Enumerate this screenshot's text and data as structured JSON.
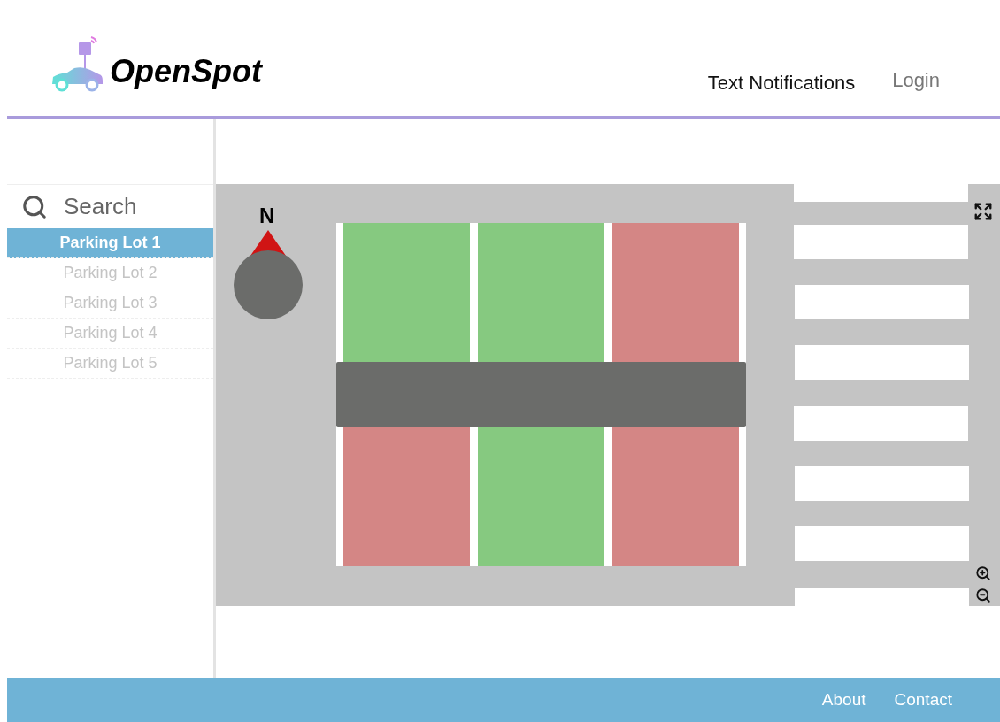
{
  "brand": {
    "name": "OpenSpot"
  },
  "nav": [
    {
      "label": "Text Notifications",
      "selected": true
    },
    {
      "label": "Login",
      "selected": false
    }
  ],
  "search": {
    "placeholder": "Search"
  },
  "lots": [
    {
      "label": "Parking Lot 1",
      "selected": true
    },
    {
      "label": "Parking Lot 2",
      "selected": false
    },
    {
      "label": "Parking Lot 3",
      "selected": false
    },
    {
      "label": "Parking Lot 4",
      "selected": false
    },
    {
      "label": "Parking Lot 5",
      "selected": false
    }
  ],
  "map": {
    "compass": "N",
    "spots": [
      {
        "occupied": false
      },
      {
        "occupied": false
      },
      {
        "occupied": true
      },
      {
        "occupied": true
      },
      {
        "occupied": false
      },
      {
        "occupied": true
      }
    ]
  },
  "footer": {
    "links": [
      "About",
      "Contact"
    ]
  }
}
